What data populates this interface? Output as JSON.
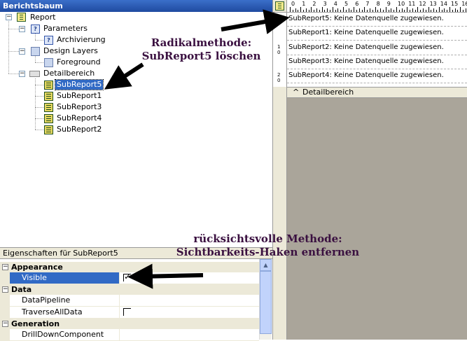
{
  "tree_panel": {
    "title": "Berichtsbaum",
    "close_glyph": "×",
    "nodes": [
      {
        "label": "Report",
        "icon": "report-icon",
        "expander": "−"
      },
      {
        "label": "Parameters",
        "icon": "parameters-icon",
        "expander": "−"
      },
      {
        "label": "Archivierung",
        "icon": "parameter-icon"
      },
      {
        "label": "Design Layers",
        "icon": "layers-icon",
        "expander": "−"
      },
      {
        "label": "Foreground",
        "icon": "layer-icon"
      },
      {
        "label": "Detailbereich",
        "icon": "band-icon",
        "expander": "−"
      },
      {
        "label": "SubReport5",
        "icon": "subreport-icon",
        "selected": true
      },
      {
        "label": "SubReport1",
        "icon": "subreport-icon"
      },
      {
        "label": "SubReport3",
        "icon": "subreport-icon"
      },
      {
        "label": "SubReport4",
        "icon": "subreport-icon"
      },
      {
        "label": "SubReport2",
        "icon": "subreport-icon"
      }
    ]
  },
  "properties_panel": {
    "title": "Eigenschaften für SubReport5",
    "categories": [
      {
        "label": "Appearance",
        "expander": "−"
      },
      {
        "label": "Data",
        "expander": "−"
      },
      {
        "label": "Generation",
        "expander": "−"
      }
    ],
    "properties": [
      {
        "name": "Visible",
        "checked": true,
        "selected": true
      },
      {
        "name": "DataPipeline",
        "value": ""
      },
      {
        "name": "TraverseAllData",
        "checked": false
      },
      {
        "name": "DrillDownComponent",
        "value": ""
      }
    ]
  },
  "designer": {
    "ruler_numbers": [
      "0",
      "1",
      "2",
      "3",
      "4",
      "5",
      "6",
      "7",
      "8",
      "9",
      "10",
      "11",
      "12",
      "13",
      "14",
      "15",
      "16"
    ],
    "vruler_numbers": [
      "1",
      "0",
      "2",
      "0"
    ],
    "subreport_rows": [
      "SubReport5: Keine Datenquelle zugewiesen.",
      "SubReport1: Keine Datenquelle zugewiesen.",
      "SubReport2: Keine Datenquelle zugewiesen.",
      "SubReport3: Keine Datenquelle zugewiesen.",
      "SubReport4: Keine Datenquelle zugewiesen."
    ],
    "band_caret": "^",
    "band_label": "Detailbereich"
  },
  "annotations": {
    "radical_line1": "Radikalmethode:",
    "radical_line2": "SubReport5 löschen",
    "gentle_line1": "rücksichtsvolle Methode:",
    "gentle_line2": "Sichtbarkeits-Haken entfernen"
  },
  "colors": {
    "title_bar": "#1f4aa0",
    "selection": "#316ac5",
    "designer_background": "#aaa59a",
    "annotation_text": "#3a1040"
  }
}
